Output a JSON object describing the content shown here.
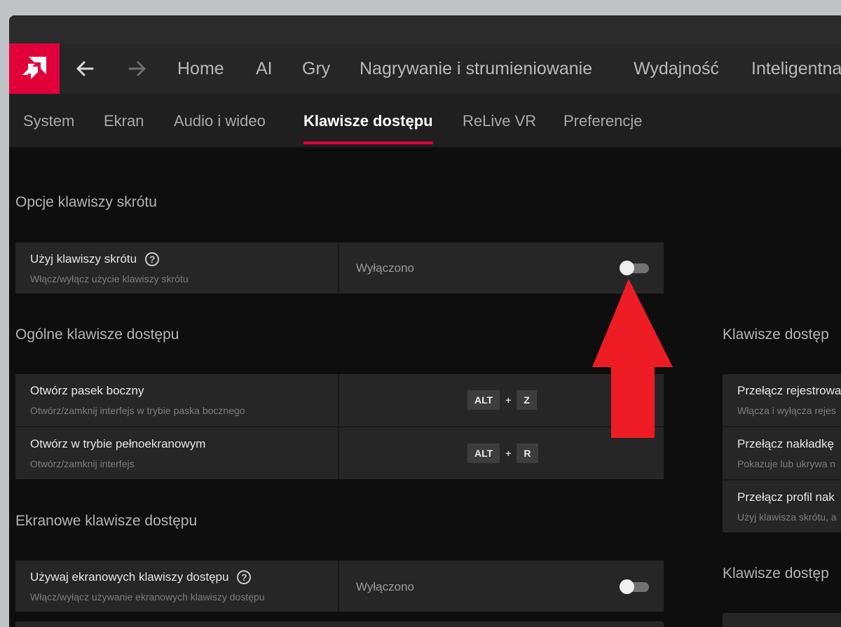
{
  "nav": {
    "tabs": [
      "Home",
      "AI",
      "Gry",
      "Nagrywanie i strumieniowanie",
      "Wydajność",
      "Inteligentna"
    ]
  },
  "subnav": {
    "tabs": [
      "System",
      "Ekran",
      "Audio i wideo",
      "Klawisze dostępu",
      "ReLive VR",
      "Preferencje"
    ],
    "active": "Klawisze dostępu"
  },
  "sections": {
    "hotkey_options": {
      "title": "Opcje klawiszy skrótu",
      "rows": [
        {
          "title": "Użyj klawiszy skrótu",
          "desc": "Włącz/wyłącz użycie klawiszy skrótu",
          "value": "Wyłączono",
          "toggle_on": false
        }
      ]
    },
    "general": {
      "title": "Ogólne klawisze dostępu",
      "rows": [
        {
          "title": "Otwórz pasek boczny",
          "desc": "Otwórz/zamknij interfejs w trybie paska bocznego",
          "key1": "ALT",
          "plus": "+",
          "key2": "Z"
        },
        {
          "title": "Otwórz w trybie pełnoekranowym",
          "desc": "Otwórz/zamknij interfejs",
          "key1": "ALT",
          "plus": "+",
          "key2": "R"
        }
      ]
    },
    "screen": {
      "title": "Ekranowe klawisze dostępu",
      "rows": [
        {
          "title": "Używaj ekranowych klawiszy dostępu",
          "desc": "Włącz/wyłącz używanie ekranowych klawiszy dostępu",
          "value": "Wyłączono",
          "toggle_on": false
        }
      ]
    },
    "right_top": {
      "title": "Klawisze dostęp",
      "rows": [
        {
          "title": "Przełącz rejestrowa",
          "desc": "Włącza i wyłącza rejes"
        },
        {
          "title": "Przełącz nakładkę",
          "desc": "Pokazuje lub ukrywa n"
        },
        {
          "title": "Przełącz profil nak",
          "desc": "Użyj klawisza skrótu, a"
        }
      ]
    },
    "right_bottom": {
      "title": "Klawisze dostęp"
    }
  },
  "colors": {
    "accent": "#e2003a",
    "annotation_arrow": "#ed1c24"
  },
  "icons": {
    "logo": "amd-logo",
    "back": "arrow-left-icon",
    "forward": "arrow-right-icon",
    "help": "question-circle-icon"
  }
}
